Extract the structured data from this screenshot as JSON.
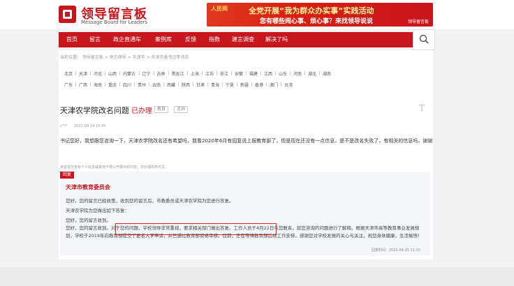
{
  "header": {
    "logo_title": "领导留言板",
    "logo_subtitle": "Message Board for Leaders",
    "banner": {
      "emblem": "人民网",
      "line1": "全党开展“我为群众办实事”实践活动",
      "line2": "您有哪些闹心事、烦心事？来找领导说说",
      "tag": "领导留言板"
    }
  },
  "nav": {
    "items": [
      "首页",
      "留言",
      "政企直通车",
      "案例库",
      "反馈",
      "指数",
      "建言调查",
      "解决了吗"
    ]
  },
  "breadcrumb": "当前位置： 领导留言板 > 地方领导 > 天津市 > 天津市委书记李鸿忠",
  "regions": {
    "row1": [
      "北京",
      "天津",
      "河北",
      "山西",
      "内蒙古",
      "辽宁",
      "吉林",
      "黑龙江",
      "上海",
      "江苏",
      "浙江",
      "安徽",
      "福建",
      "江西",
      "山东",
      "河南",
      "湖北",
      "湖南"
    ],
    "row2": [
      "广东",
      "广西",
      "海南",
      "重庆",
      "四川",
      "贵州",
      "云南",
      "西藏",
      "陕西",
      "甘肃",
      "青海",
      "宁夏",
      "新疆",
      "香港",
      "澳门",
      "台湾"
    ]
  },
  "message": {
    "title": "天津农学院改名问题",
    "status": "已办理",
    "tags": [
      "教育",
      "咨询"
    ],
    "font_button": "T",
    "author_time": "c***　　2021-04-14 15:45",
    "body": "书记您好，我想跟您咨询一下，天津农学院改名还有希望吗，我看2020年6月有回复说上报教育部了，但是现在还没有一点信息，是不是改名失败了，有相关的信息吗，谢谢",
    "notice": "该留言中含有个人信息或其他不便公开展示的内容，仅办理机构可见。"
  },
  "reply": {
    "label": "回复",
    "org": "天津市教育委员会",
    "lines": [
      "您好。您的留言已经收悉，收到您的留言后，市教委员或天津农学院为您进行答复。",
      "天津农学院为您做出如下答复：",
      "您好，您的留言收到。"
    ],
    "para": "您好，您的留言收到。对于您的问题，学校领导非常重视，要求相关部门做出答复。工作人员于4月22日与您联系，就您咨询的问题进行了解释。根据天津市高等教育事业发展规划，学校于2019年向教育部提交了更名大学申请，并已通过教育部资格审核。目前，正在等待教育部后续工作安排。感谢您对学校发展的关心与关注，祝您身体健康，生活愉快！",
    "date": "回复时间：2021-04-25 11:15"
  },
  "colors": {
    "brand": "#c8161d",
    "highlight": "#e02020"
  }
}
